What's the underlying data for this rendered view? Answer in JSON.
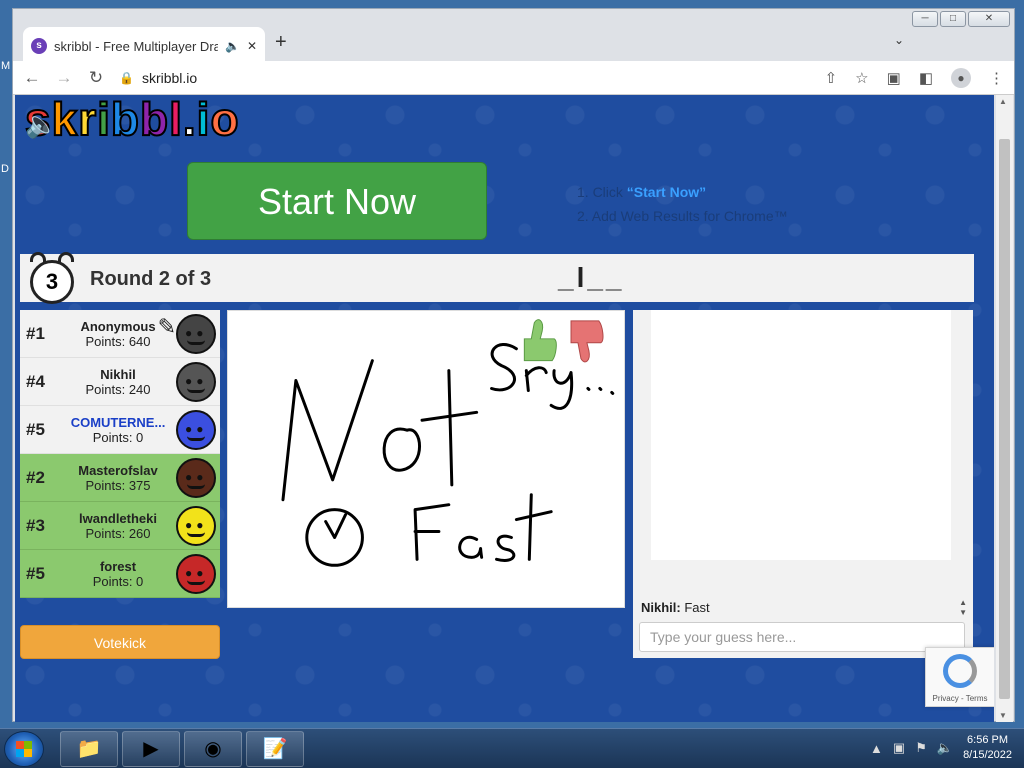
{
  "browser": {
    "tab_title": "skribbl - Free Multiplayer Dra",
    "url": "skribbl.io"
  },
  "page": {
    "logo_text": "skribbl.io",
    "ad": {
      "button_label": "Start Now",
      "step1_prefix": "1. Click ",
      "step1_link": "“Start Now”",
      "step2": "2. Add Web Results for Chrome™"
    },
    "timer": "3",
    "round_text": "Round 2 of 3",
    "word_hint": "_l__",
    "players": [
      {
        "rank": "#1",
        "name": "Anonymous",
        "points": "Points: 640",
        "guessed": false,
        "me": false,
        "color": "#444444",
        "drawing": true
      },
      {
        "rank": "#4",
        "name": "Nikhil",
        "points": "Points: 240",
        "guessed": false,
        "me": false,
        "color": "#555555",
        "drawing": false
      },
      {
        "rank": "#5",
        "name": "COMUTERNE...",
        "points": "Points: 0",
        "guessed": false,
        "me": true,
        "color": "#3b4fe0",
        "drawing": false
      },
      {
        "rank": "#2",
        "name": "Masterofslav",
        "points": "Points: 375",
        "guessed": true,
        "me": false,
        "color": "#5a2a1a",
        "drawing": false
      },
      {
        "rank": "#3",
        "name": "lwandletheki",
        "points": "Points: 260",
        "guessed": true,
        "me": false,
        "color": "#f2e21a",
        "drawing": false
      },
      {
        "rank": "#5",
        "name": "forest",
        "points": "Points: 0",
        "guessed": true,
        "me": false,
        "color": "#c62828",
        "drawing": false
      }
    ],
    "votekick_label": "Votekick",
    "chat": {
      "last_sender": "Nikhil:",
      "last_message": "Fast",
      "input_placeholder": "Type your guess here..."
    },
    "recaptcha_terms": "Privacy - Terms"
  },
  "taskbar": {
    "time": "6:56 PM",
    "date": "8/15/2022"
  }
}
